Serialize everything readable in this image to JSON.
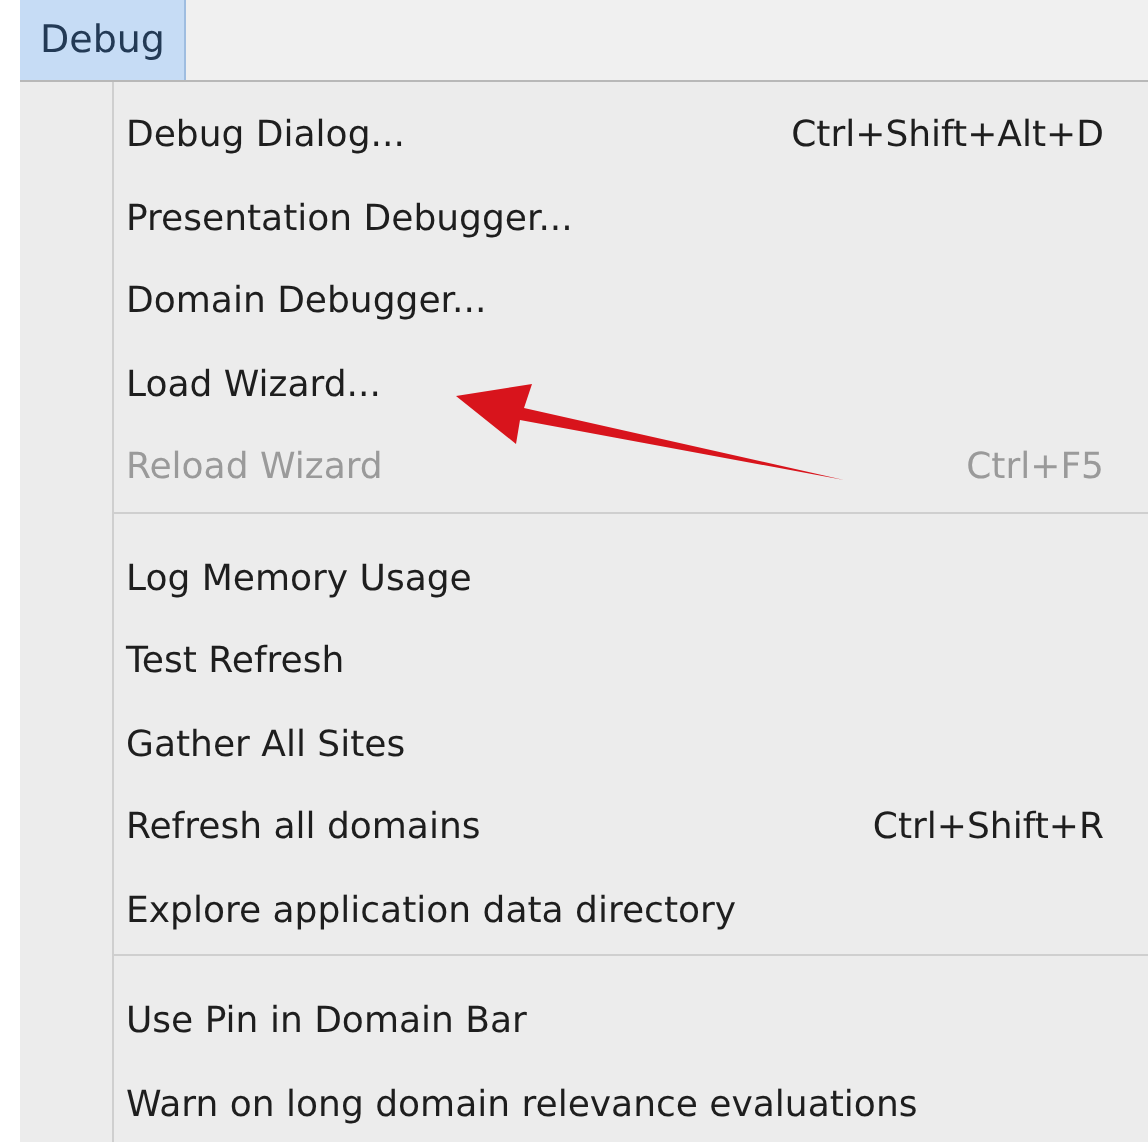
{
  "menu_bar": {
    "title": "Debug",
    "selected": true
  },
  "sections": [
    {
      "items": [
        {
          "label": "Debug Dialog...",
          "shortcut": "Ctrl+Shift+Alt+D",
          "disabled": false
        },
        {
          "label": "Presentation Debugger...",
          "disabled": false
        },
        {
          "label": "Domain Debugger...",
          "disabled": false
        },
        {
          "label": "Load Wizard...",
          "disabled": false
        },
        {
          "label": "Reload Wizard",
          "shortcut": "Ctrl+F5",
          "disabled": true
        }
      ]
    },
    {
      "items": [
        {
          "label": "Log Memory Usage",
          "disabled": false
        },
        {
          "label": "Test Refresh",
          "disabled": false
        },
        {
          "label": "Gather All Sites",
          "disabled": false
        },
        {
          "label": "Refresh all domains",
          "shortcut": "Ctrl+Shift+R",
          "disabled": false
        },
        {
          "label": "Explore application data directory",
          "disabled": false
        }
      ]
    },
    {
      "items": [
        {
          "label": "Use Pin in Domain Bar",
          "disabled": false
        },
        {
          "label": "Warn on long domain relevance evaluations",
          "disabled": false
        }
      ]
    }
  ]
}
